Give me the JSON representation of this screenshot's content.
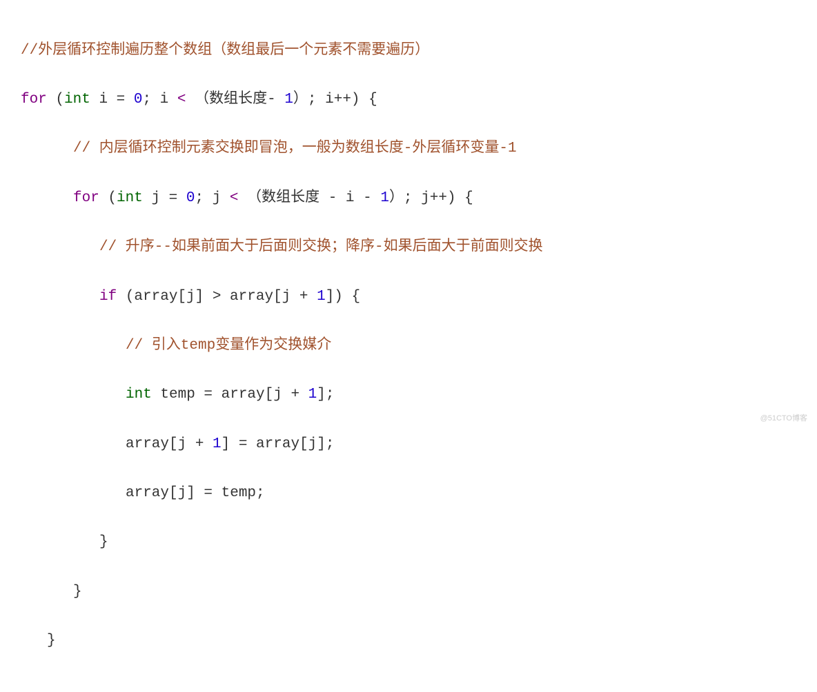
{
  "code": {
    "c1": "//外层循环控制遍历整个数组（数组最后一个元素不需要遍历）",
    "l2_for": "for",
    "l2_paren_open": " (",
    "l2_int": "int",
    "l2_var": " i = ",
    "l2_zero": "0",
    "l2_semi1": "; i ",
    "l2_lt": "<",
    "l2_cond": " （数组长度- ",
    "l2_one": "1",
    "l2_close": "）; i++) {",
    "c2": "// 内层循环控制元素交换即冒泡，一般为数组长度-外层循环变量-1",
    "l4_for": "for",
    "l4_paren_open": " (",
    "l4_int": "int",
    "l4_var": " j = ",
    "l4_zero": "0",
    "l4_semi1": "; j ",
    "l4_lt": "<",
    "l4_cond": " （数组长度 - i - ",
    "l4_one": "1",
    "l4_close": "）; j++) {",
    "c3": "// 升序--如果前面大于后面则交换；降序-如果后面大于前面则交换",
    "l6_if": "if",
    "l6_body": " (array[j] > array[j + ",
    "l6_one": "1",
    "l6_close": "]) {",
    "c4": "// 引入temp变量作为交换媒介",
    "l8_int": "int",
    "l8_body": " temp = array[j + ",
    "l8_one": "1",
    "l8_close": "];",
    "l9_body": "array[j + ",
    "l9_one": "1",
    "l9_close": "] = array[j];",
    "l10_body": "array[j] = temp;",
    "l11": "}",
    "l12": "}",
    "l13": "}"
  },
  "watermark": "@51CTO博客"
}
